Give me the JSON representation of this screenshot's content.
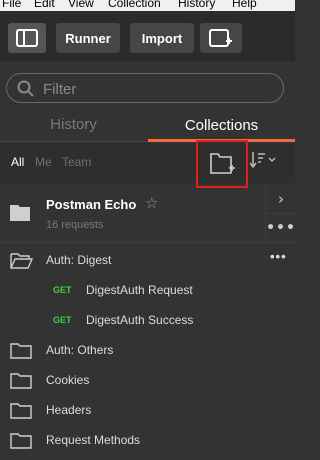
{
  "menu": [
    "File",
    "Edit",
    "View",
    "Collection",
    "History",
    "Help"
  ],
  "toolbar": {
    "runner": "Runner",
    "import": "Import"
  },
  "search": {
    "placeholder": "Filter"
  },
  "tabs": {
    "history": "History",
    "collections": "Collections"
  },
  "filters": {
    "all": "All",
    "me": "Me",
    "team": "Team"
  },
  "collection": {
    "name": "Postman Echo",
    "count": "16 requests",
    "more": "•••"
  },
  "tree": {
    "auth_digest": "Auth: Digest",
    "req1_method": "GET",
    "req1_name": "DigestAuth Request",
    "req2_method": "GET",
    "req2_name": "DigestAuth Success",
    "auth_others": "Auth: Others",
    "cookies": "Cookies",
    "headers": "Headers",
    "request_methods": "Request Methods",
    "more": "•••"
  },
  "colors": {
    "accent": "#f26b3a",
    "get": "#3fce3f",
    "highlight": "#e02020"
  }
}
